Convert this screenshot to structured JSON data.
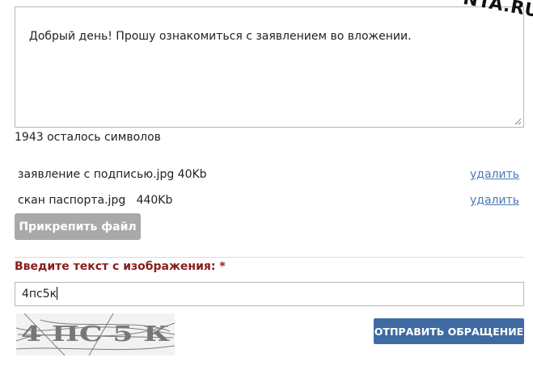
{
  "message": {
    "value": "Добрый день! Прошу ознакомиться с заявлением во вложении."
  },
  "watermark": "NTA.RU",
  "counter": {
    "text": "1943 осталось символов"
  },
  "attachments": [
    {
      "name": "заявление с подписью.jpg 40Kb",
      "delete_label": "удалить"
    },
    {
      "name": "скан паспорта.jpg   440Kb",
      "delete_label": "удалить"
    }
  ],
  "attach_button": {
    "label": "Прикрепить файл"
  },
  "captcha": {
    "label": "Введите текст с изображения:",
    "required_mark": "*",
    "input_value": "4пс5к",
    "image_text": "4 ПС 5 К"
  },
  "submit_button": {
    "label": "ОТПРАВИТЬ ОБРАЩЕНИЕ"
  },
  "colors": {
    "label_red": "#8a1c1c",
    "link_blue": "#4a79b8",
    "button_gray": "#a9a9a9",
    "button_blue": "#3f6ba2"
  }
}
